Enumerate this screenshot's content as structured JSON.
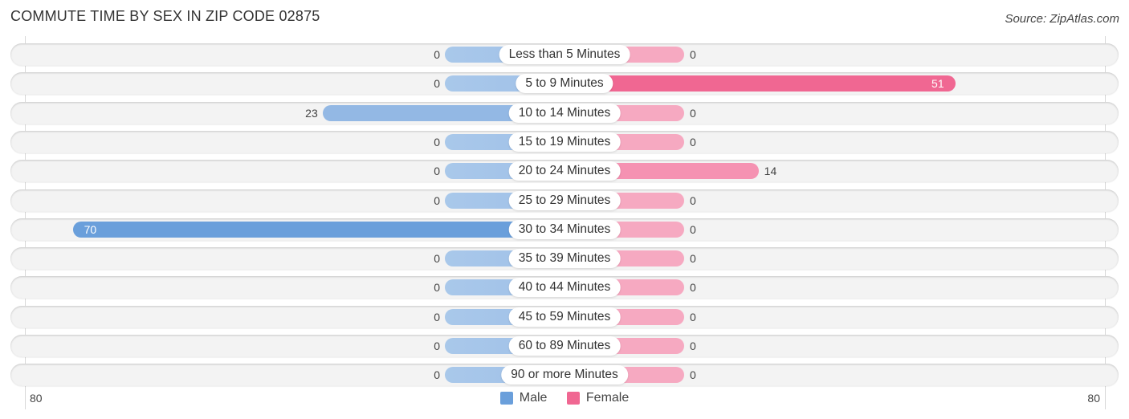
{
  "header": {
    "title": "COMMUTE TIME BY SEX IN ZIP CODE 02875",
    "source": "Source: ZipAtlas.com"
  },
  "colors": {
    "male": "#6a9fdb",
    "male_light": "#a9c8ea",
    "female": "#f06792",
    "female_light": "#f6a9c1",
    "row_bg": "#f3f3f3"
  },
  "legend": [
    {
      "label": "Male",
      "color": "#6a9fdb"
    },
    {
      "label": "Female",
      "color": "#f06792"
    }
  ],
  "axis": {
    "left_tick": "80",
    "right_tick": "80"
  },
  "chart_data": {
    "type": "bar",
    "orientation": "horizontal-diverging",
    "title": "COMMUTE TIME BY SEX IN ZIP CODE 02875",
    "categories": [
      "Less than 5 Minutes",
      "5 to 9 Minutes",
      "10 to 14 Minutes",
      "15 to 19 Minutes",
      "20 to 24 Minutes",
      "25 to 29 Minutes",
      "30 to 34 Minutes",
      "35 to 39 Minutes",
      "40 to 44 Minutes",
      "45 to 59 Minutes",
      "60 to 89 Minutes",
      "90 or more Minutes"
    ],
    "series": [
      {
        "name": "Male",
        "values": [
          0,
          0,
          23,
          0,
          0,
          0,
          70,
          0,
          0,
          0,
          0,
          0
        ]
      },
      {
        "name": "Female",
        "values": [
          0,
          51,
          0,
          0,
          14,
          0,
          0,
          0,
          0,
          0,
          0,
          0
        ]
      }
    ],
    "xlim": [
      -80,
      80
    ],
    "xtick_labels": [
      "80",
      "80"
    ],
    "legend_position": "bottom-center",
    "grid": false
  }
}
